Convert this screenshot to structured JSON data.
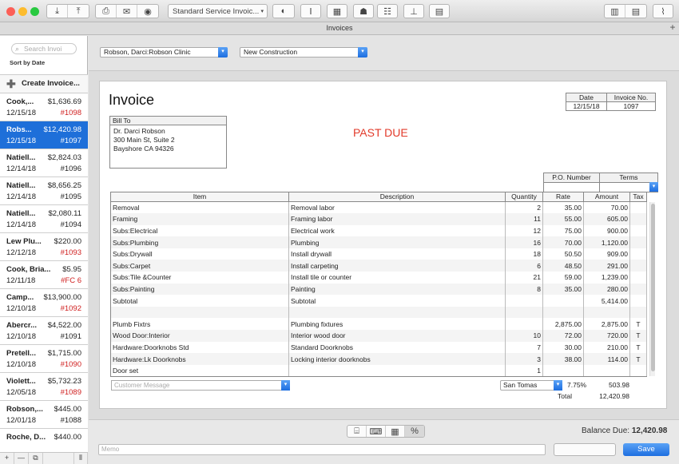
{
  "window": {
    "title": "Invoices",
    "template_select": "Standard Service Invoic...",
    "traffic_colors": [
      "#fc5f57",
      "#fdbc2e",
      "#28c940"
    ]
  },
  "toolbar_icons": [
    "download-arrow-icon",
    "upload-arrow-icon",
    "print-icon",
    "email-icon",
    "preview-eye-icon",
    "template-icon",
    "text-format-icon",
    "layout-icon",
    "customers-icon",
    "team-icon",
    "stamp-icon",
    "printer-icon",
    "column-view-icon",
    "list-view-icon",
    "attach-icon"
  ],
  "sidebar": {
    "search_placeholder": "Search Invoi",
    "sort_label": "Sort by Date",
    "create_label": "Create Invoice...",
    "items": [
      {
        "name": "Cook,...",
        "amount": "$1,636.69",
        "date": "12/15/18",
        "num": "#1098",
        "red": true
      },
      {
        "name": "Robs...",
        "amount": "$12,420.98",
        "date": "12/15/18",
        "num": "#1097",
        "red": true,
        "selected": true
      },
      {
        "name": "Natiell...",
        "amount": "$2,824.03",
        "date": "12/14/18",
        "num": "#1096",
        "red": false
      },
      {
        "name": "Natiell...",
        "amount": "$8,656.25",
        "date": "12/14/18",
        "num": "#1095",
        "red": false
      },
      {
        "name": "Natiell...",
        "amount": "$2,080.11",
        "date": "12/14/18",
        "num": "#1094",
        "red": false
      },
      {
        "name": "Lew Plu...",
        "amount": "$220.00",
        "date": "12/12/18",
        "num": "#1093",
        "red": true
      },
      {
        "name": "Cook, Bria...",
        "amount": "$5.95",
        "date": "12/11/18",
        "num": "#FC 6",
        "red": true
      },
      {
        "name": "Camp...",
        "amount": "$13,900.00",
        "date": "12/10/18",
        "num": "#1092",
        "red": true
      },
      {
        "name": "Abercr...",
        "amount": "$4,522.00",
        "date": "12/10/18",
        "num": "#1091",
        "red": false
      },
      {
        "name": "Pretell...",
        "amount": "$1,715.00",
        "date": "12/10/18",
        "num": "#1090",
        "red": true
      },
      {
        "name": "Violett...",
        "amount": "$5,732.23",
        "date": "12/05/18",
        "num": "#1089",
        "red": true
      },
      {
        "name": "Robson,...",
        "amount": "$445.00",
        "date": "12/01/18",
        "num": "#1088",
        "red": false
      },
      {
        "name": "Roche, D...",
        "amount": "$440.00",
        "date": "",
        "num": "",
        "red": false
      }
    ],
    "footer_buttons": [
      "+",
      "—",
      "⧉",
      "⦀"
    ]
  },
  "header": {
    "customer": "Robson, Darci:Robson Clinic",
    "job": "New Construction"
  },
  "invoice": {
    "title": "Invoice",
    "date_label": "Date",
    "date_value": "12/15/18",
    "invno_label": "Invoice No.",
    "invno_value": "1097",
    "billto_label": "Bill To",
    "billto_lines": [
      "Dr. Darci Robson",
      "300 Main St, Suite 2",
      "Bayshore CA 94326"
    ],
    "status": "PAST DUE",
    "po_label": "P.O. Number",
    "terms_label": "Terms",
    "columns": [
      "Item",
      "Description",
      "Quantity",
      "Rate",
      "Amount",
      "Tax"
    ],
    "rows": [
      [
        "Removal",
        "Removal labor",
        "2",
        "35.00",
        "70.00",
        ""
      ],
      [
        "Framing",
        "Framing labor",
        "11",
        "55.00",
        "605.00",
        ""
      ],
      [
        "Subs:Electrical",
        "Electrical work",
        "12",
        "75.00",
        "900.00",
        ""
      ],
      [
        "Subs:Plumbing",
        "Plumbing",
        "16",
        "70.00",
        "1,120.00",
        ""
      ],
      [
        "Subs:Drywall",
        "Install drywall",
        "18",
        "50.50",
        "909.00",
        ""
      ],
      [
        "Subs:Carpet",
        "Install carpeting",
        "6",
        "48.50",
        "291.00",
        ""
      ],
      [
        "Subs:Tile &Counter",
        "Install tile or counter",
        "21",
        "59.00",
        "1,239.00",
        ""
      ],
      [
        "Subs:Painting",
        "Painting",
        "8",
        "35.00",
        "280.00",
        ""
      ],
      [
        "Subtotal",
        "Subtotal",
        "",
        "",
        "5,414.00",
        ""
      ],
      [
        "",
        "",
        "",
        "",
        "",
        ""
      ],
      [
        "Plumb Fixtrs",
        "Plumbing fixtures",
        "",
        "2,875.00",
        "2,875.00",
        "T"
      ],
      [
        "Wood Door:Interior",
        "Interior wood door",
        "10",
        "72.00",
        "720.00",
        "T"
      ],
      [
        "Hardware:Doorknobs Std",
        "Standard Doorknobs",
        "7",
        "30.00",
        "210.00",
        "T"
      ],
      [
        "Hardware:Lk Doorknobs",
        "Locking interior doorknobs",
        "3",
        "38.00",
        "114.00",
        "T"
      ],
      [
        "Door set",
        "",
        "1",
        "",
        "",
        ""
      ]
    ],
    "customer_message_placeholder": "Customer Message",
    "tax_item": "San Tomas",
    "tax_rate": "7.75%",
    "tax_amount": "503.98",
    "total_label": "Total",
    "total_value": "12,420.98"
  },
  "footer": {
    "balance_label": "Balance Due:",
    "balance_value": "12,420.98",
    "memo_placeholder": "Memo",
    "save_label": "Save",
    "percent_label": "%"
  }
}
